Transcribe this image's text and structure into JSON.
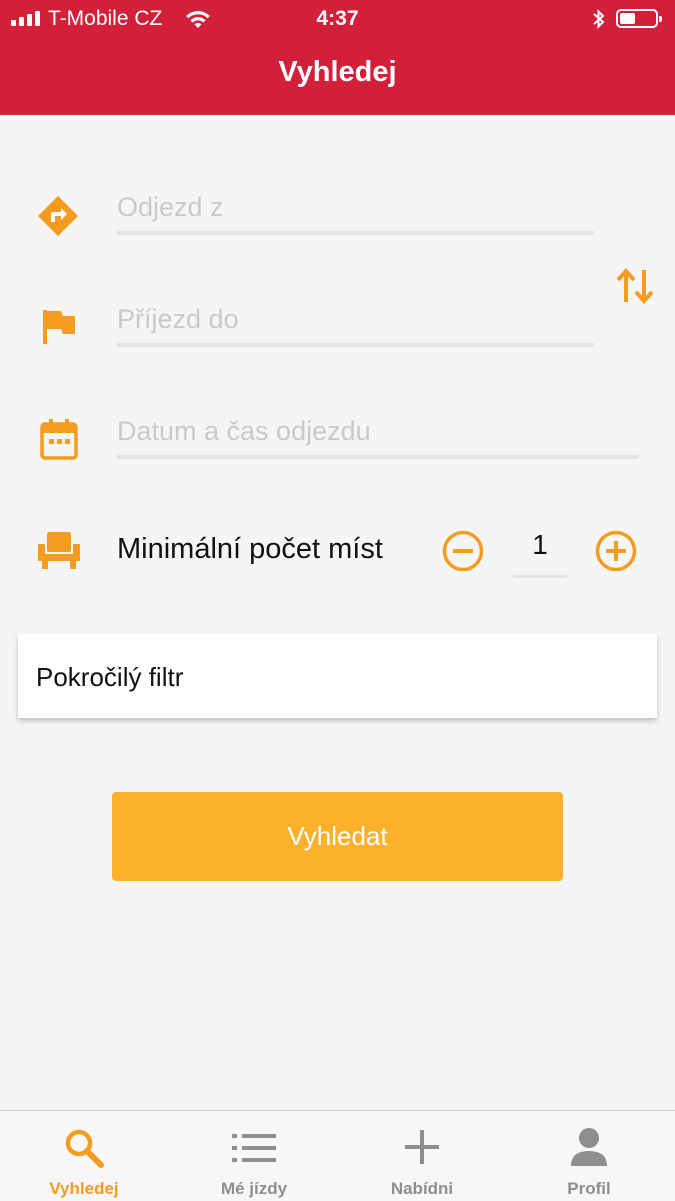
{
  "status_bar": {
    "carrier": "T-Mobile CZ",
    "time": "4:37"
  },
  "header": {
    "title": "Vyhledej"
  },
  "form": {
    "departure_placeholder": "Odjezd z",
    "arrival_placeholder": "Příjezd do",
    "datetime_placeholder": "Datum a čas odjezdu",
    "seats_label": "Minimální počet míst",
    "seats_value": "1"
  },
  "advanced_filter": {
    "label": "Pokročilý filtr"
  },
  "search_button": {
    "label": "Vyhledat"
  },
  "tabs": [
    {
      "label": "Vyhledej",
      "icon": "search-icon",
      "active": true
    },
    {
      "label": "Mé jízdy",
      "icon": "list-icon",
      "active": false
    },
    {
      "label": "Nabídni",
      "icon": "plus-icon",
      "active": false
    },
    {
      "label": "Profil",
      "icon": "person-icon",
      "active": false
    }
  ],
  "colors": {
    "header": "#d21f3a",
    "accent": "#f39c1f",
    "button": "#fbb12a",
    "background": "#f5f5f5"
  }
}
